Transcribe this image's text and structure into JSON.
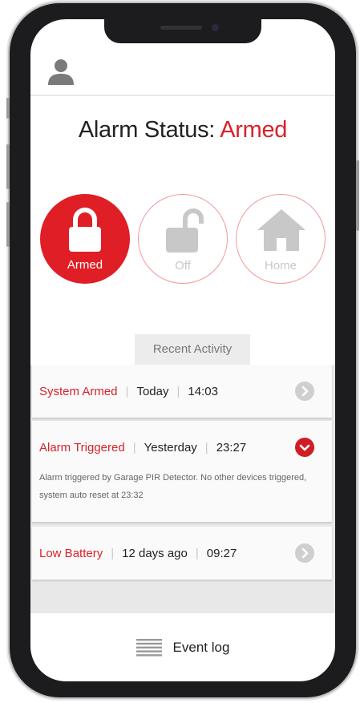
{
  "status": {
    "prefix": "Alarm Status: ",
    "value": "Armed"
  },
  "modes": [
    {
      "label": "Armed",
      "icon": "lock-closed-icon",
      "active": true
    },
    {
      "label": "Off",
      "icon": "lock-open-icon",
      "active": false
    },
    {
      "label": "Home",
      "icon": "home-icon",
      "active": false
    }
  ],
  "recent_activity": {
    "tab_label": "Recent Activity",
    "items": [
      {
        "title": "System Armed",
        "day": "Today",
        "time": "14:03",
        "expanded": false
      },
      {
        "title": "Alarm Triggered",
        "day": "Yesterday",
        "time": "23:27",
        "expanded": true,
        "description": "Alarm triggered by Garage PIR Detector. No other devices triggered, system auto reset at 23:32"
      },
      {
        "title": "Low Battery",
        "day": "12 days ago",
        "time": "09:27",
        "expanded": false
      }
    ]
  },
  "footer": {
    "event_log_label": "Event log"
  },
  "colors": {
    "accent": "#d8222a",
    "inactive_ring": "#f09a9d",
    "inactive_icon": "#c8c8c8"
  }
}
